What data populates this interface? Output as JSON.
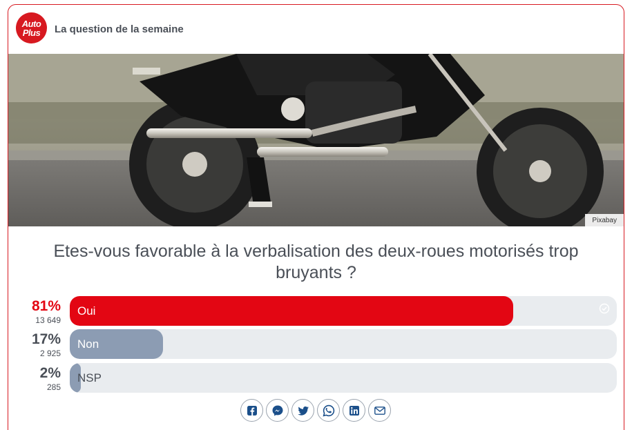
{
  "header": {
    "logo_line1": "Auto",
    "logo_line2": "Plus",
    "title": "La question de la semaine"
  },
  "image": {
    "subject": "motorcycle-photo",
    "credit": "Pixabay"
  },
  "poll": {
    "question": "Etes-vous favorable à la verbalisation des deux-roues motorisés trop bruyants ?",
    "answers": [
      {
        "label": "Oui",
        "percent_text": "81%",
        "percent": 81,
        "count": "13 649",
        "selected": true,
        "color": "#e30613",
        "label_color": "#ffffff"
      },
      {
        "label": "Non",
        "percent_text": "17%",
        "percent": 17,
        "count": "2 925",
        "selected": false,
        "color": "#8c9cb3",
        "label_color": "#ffffff"
      },
      {
        "label": "NSP",
        "percent_text": "2%",
        "percent": 2,
        "count": "285",
        "selected": false,
        "color": "#8c9cb3",
        "label_color": "#4a4f57"
      }
    ]
  },
  "colors": {
    "brand": "#d71920",
    "selected_pct": "#e30613",
    "other_pct": "#4a4f57",
    "share_icons": "#1b4f8a"
  },
  "share": [
    {
      "icon": "facebook-icon"
    },
    {
      "icon": "messenger-icon"
    },
    {
      "icon": "twitter-icon"
    },
    {
      "icon": "whatsapp-icon"
    },
    {
      "icon": "linkedin-icon"
    },
    {
      "icon": "email-icon"
    }
  ]
}
